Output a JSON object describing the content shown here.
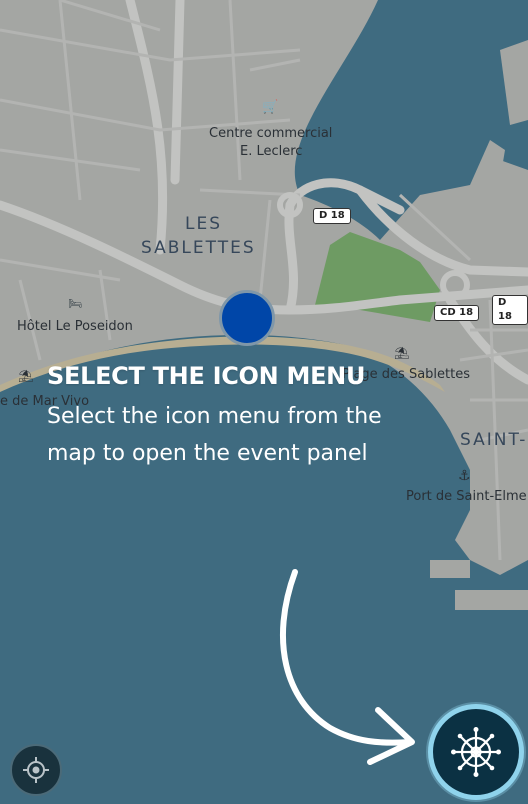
{
  "map": {
    "labels": {
      "centre_commercial": "Centre commercial",
      "leclerc": "E. Leclerc",
      "les": "LES",
      "sablettes": "SABLETTES",
      "hotel": "Hôtel Le Poseidon",
      "mar_vivo": "e de Mar Vivo",
      "plage": "Plage des Sablettes",
      "saint": "SAINT-",
      "port": "Port de Saint-Elme"
    },
    "roads": {
      "d18_top": "D 18",
      "cd18": "CD 18",
      "d18_right": "D 18"
    },
    "colors": {
      "land": "#a4a6a3",
      "water": "#3f6b80",
      "park": "#6e9b63",
      "road": "#c4c5c3"
    }
  },
  "overlay": {
    "title": "SELECT THE ICON MENU",
    "body": "Select the icon menu from the map to open the event panel"
  },
  "controls": {
    "locate_icon": "crosshair-icon",
    "menu_icon": "ship-wheel-icon",
    "menu_ring_color": "#8fd3ec"
  }
}
